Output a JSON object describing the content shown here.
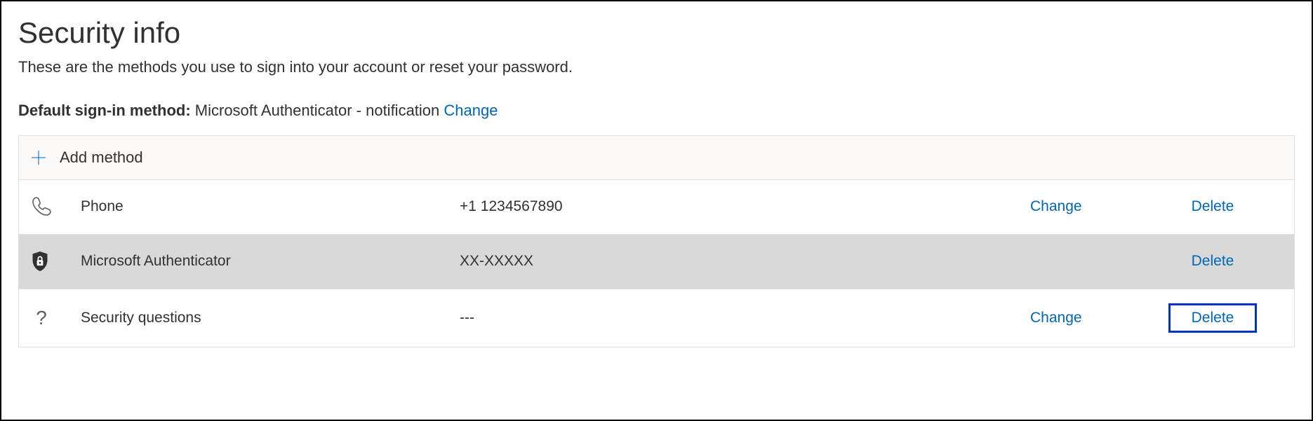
{
  "header": {
    "title": "Security info",
    "subtitle": "These are the methods you use to sign into your account or reset your password."
  },
  "default_method": {
    "label": "Default sign-in method:",
    "value": "Microsoft Authenticator - notification",
    "change_label": "Change"
  },
  "add_method": {
    "label": "Add method"
  },
  "actions": {
    "change": "Change",
    "delete": "Delete"
  },
  "methods": [
    {
      "icon": "phone",
      "name": "Phone",
      "value": "+1 1234567890",
      "has_change": true,
      "has_delete": true,
      "highlighted": false,
      "delete_focused": false
    },
    {
      "icon": "authenticator",
      "name": "Microsoft Authenticator",
      "value": "XX-XXXXX",
      "has_change": false,
      "has_delete": true,
      "highlighted": true,
      "delete_focused": false
    },
    {
      "icon": "question",
      "name": "Security questions",
      "value": "---",
      "has_change": true,
      "has_delete": true,
      "highlighted": false,
      "delete_focused": true
    }
  ]
}
